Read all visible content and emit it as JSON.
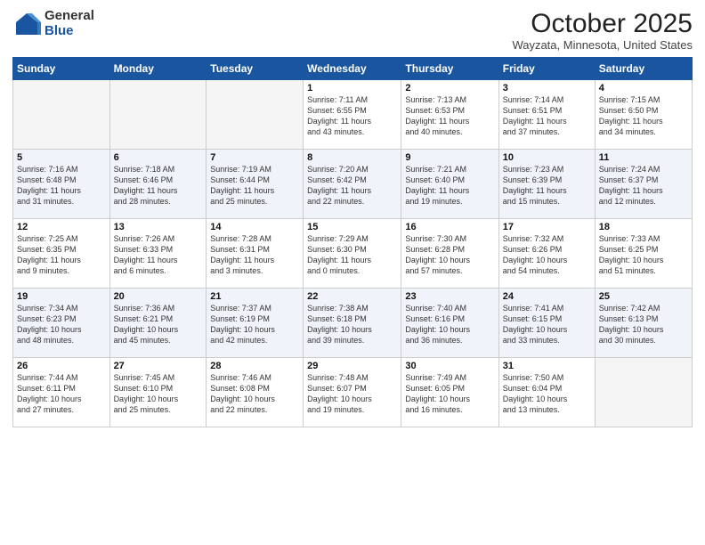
{
  "header": {
    "logo_general": "General",
    "logo_blue": "Blue",
    "month_title": "October 2025",
    "location": "Wayzata, Minnesota, United States"
  },
  "weekdays": [
    "Sunday",
    "Monday",
    "Tuesday",
    "Wednesday",
    "Thursday",
    "Friday",
    "Saturday"
  ],
  "weeks": [
    [
      {
        "day": "",
        "info": ""
      },
      {
        "day": "",
        "info": ""
      },
      {
        "day": "",
        "info": ""
      },
      {
        "day": "1",
        "info": "Sunrise: 7:11 AM\nSunset: 6:55 PM\nDaylight: 11 hours\nand 43 minutes."
      },
      {
        "day": "2",
        "info": "Sunrise: 7:13 AM\nSunset: 6:53 PM\nDaylight: 11 hours\nand 40 minutes."
      },
      {
        "day": "3",
        "info": "Sunrise: 7:14 AM\nSunset: 6:51 PM\nDaylight: 11 hours\nand 37 minutes."
      },
      {
        "day": "4",
        "info": "Sunrise: 7:15 AM\nSunset: 6:50 PM\nDaylight: 11 hours\nand 34 minutes."
      }
    ],
    [
      {
        "day": "5",
        "info": "Sunrise: 7:16 AM\nSunset: 6:48 PM\nDaylight: 11 hours\nand 31 minutes."
      },
      {
        "day": "6",
        "info": "Sunrise: 7:18 AM\nSunset: 6:46 PM\nDaylight: 11 hours\nand 28 minutes."
      },
      {
        "day": "7",
        "info": "Sunrise: 7:19 AM\nSunset: 6:44 PM\nDaylight: 11 hours\nand 25 minutes."
      },
      {
        "day": "8",
        "info": "Sunrise: 7:20 AM\nSunset: 6:42 PM\nDaylight: 11 hours\nand 22 minutes."
      },
      {
        "day": "9",
        "info": "Sunrise: 7:21 AM\nSunset: 6:40 PM\nDaylight: 11 hours\nand 19 minutes."
      },
      {
        "day": "10",
        "info": "Sunrise: 7:23 AM\nSunset: 6:39 PM\nDaylight: 11 hours\nand 15 minutes."
      },
      {
        "day": "11",
        "info": "Sunrise: 7:24 AM\nSunset: 6:37 PM\nDaylight: 11 hours\nand 12 minutes."
      }
    ],
    [
      {
        "day": "12",
        "info": "Sunrise: 7:25 AM\nSunset: 6:35 PM\nDaylight: 11 hours\nand 9 minutes."
      },
      {
        "day": "13",
        "info": "Sunrise: 7:26 AM\nSunset: 6:33 PM\nDaylight: 11 hours\nand 6 minutes."
      },
      {
        "day": "14",
        "info": "Sunrise: 7:28 AM\nSunset: 6:31 PM\nDaylight: 11 hours\nand 3 minutes."
      },
      {
        "day": "15",
        "info": "Sunrise: 7:29 AM\nSunset: 6:30 PM\nDaylight: 11 hours\nand 0 minutes."
      },
      {
        "day": "16",
        "info": "Sunrise: 7:30 AM\nSunset: 6:28 PM\nDaylight: 10 hours\nand 57 minutes."
      },
      {
        "day": "17",
        "info": "Sunrise: 7:32 AM\nSunset: 6:26 PM\nDaylight: 10 hours\nand 54 minutes."
      },
      {
        "day": "18",
        "info": "Sunrise: 7:33 AM\nSunset: 6:25 PM\nDaylight: 10 hours\nand 51 minutes."
      }
    ],
    [
      {
        "day": "19",
        "info": "Sunrise: 7:34 AM\nSunset: 6:23 PM\nDaylight: 10 hours\nand 48 minutes."
      },
      {
        "day": "20",
        "info": "Sunrise: 7:36 AM\nSunset: 6:21 PM\nDaylight: 10 hours\nand 45 minutes."
      },
      {
        "day": "21",
        "info": "Sunrise: 7:37 AM\nSunset: 6:19 PM\nDaylight: 10 hours\nand 42 minutes."
      },
      {
        "day": "22",
        "info": "Sunrise: 7:38 AM\nSunset: 6:18 PM\nDaylight: 10 hours\nand 39 minutes."
      },
      {
        "day": "23",
        "info": "Sunrise: 7:40 AM\nSunset: 6:16 PM\nDaylight: 10 hours\nand 36 minutes."
      },
      {
        "day": "24",
        "info": "Sunrise: 7:41 AM\nSunset: 6:15 PM\nDaylight: 10 hours\nand 33 minutes."
      },
      {
        "day": "25",
        "info": "Sunrise: 7:42 AM\nSunset: 6:13 PM\nDaylight: 10 hours\nand 30 minutes."
      }
    ],
    [
      {
        "day": "26",
        "info": "Sunrise: 7:44 AM\nSunset: 6:11 PM\nDaylight: 10 hours\nand 27 minutes."
      },
      {
        "day": "27",
        "info": "Sunrise: 7:45 AM\nSunset: 6:10 PM\nDaylight: 10 hours\nand 25 minutes."
      },
      {
        "day": "28",
        "info": "Sunrise: 7:46 AM\nSunset: 6:08 PM\nDaylight: 10 hours\nand 22 minutes."
      },
      {
        "day": "29",
        "info": "Sunrise: 7:48 AM\nSunset: 6:07 PM\nDaylight: 10 hours\nand 19 minutes."
      },
      {
        "day": "30",
        "info": "Sunrise: 7:49 AM\nSunset: 6:05 PM\nDaylight: 10 hours\nand 16 minutes."
      },
      {
        "day": "31",
        "info": "Sunrise: 7:50 AM\nSunset: 6:04 PM\nDaylight: 10 hours\nand 13 minutes."
      },
      {
        "day": "",
        "info": ""
      }
    ]
  ]
}
